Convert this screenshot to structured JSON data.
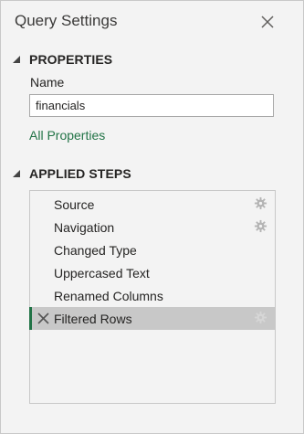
{
  "pane": {
    "title": "Query Settings"
  },
  "properties": {
    "heading": "PROPERTIES",
    "name_label": "Name",
    "name_value": "financials",
    "all_properties_link": "All Properties"
  },
  "applied_steps": {
    "heading": "APPLIED STEPS",
    "steps": [
      {
        "label": "Source",
        "has_settings": true,
        "selected": false
      },
      {
        "label": "Navigation",
        "has_settings": true,
        "selected": false
      },
      {
        "label": "Changed Type",
        "has_settings": false,
        "selected": false
      },
      {
        "label": "Uppercased Text",
        "has_settings": false,
        "selected": false
      },
      {
        "label": "Renamed Columns",
        "has_settings": false,
        "selected": false
      },
      {
        "label": "Filtered Rows",
        "has_settings": true,
        "selected": true
      }
    ]
  },
  "colors": {
    "accent": "#217346",
    "selected_row": "#c8c8c8",
    "background": "#f3f3f3"
  },
  "icons": {
    "close": "close-icon",
    "collapse": "collapse-triangle-icon",
    "settings": "gear-icon",
    "delete": "delete-step-icon"
  }
}
